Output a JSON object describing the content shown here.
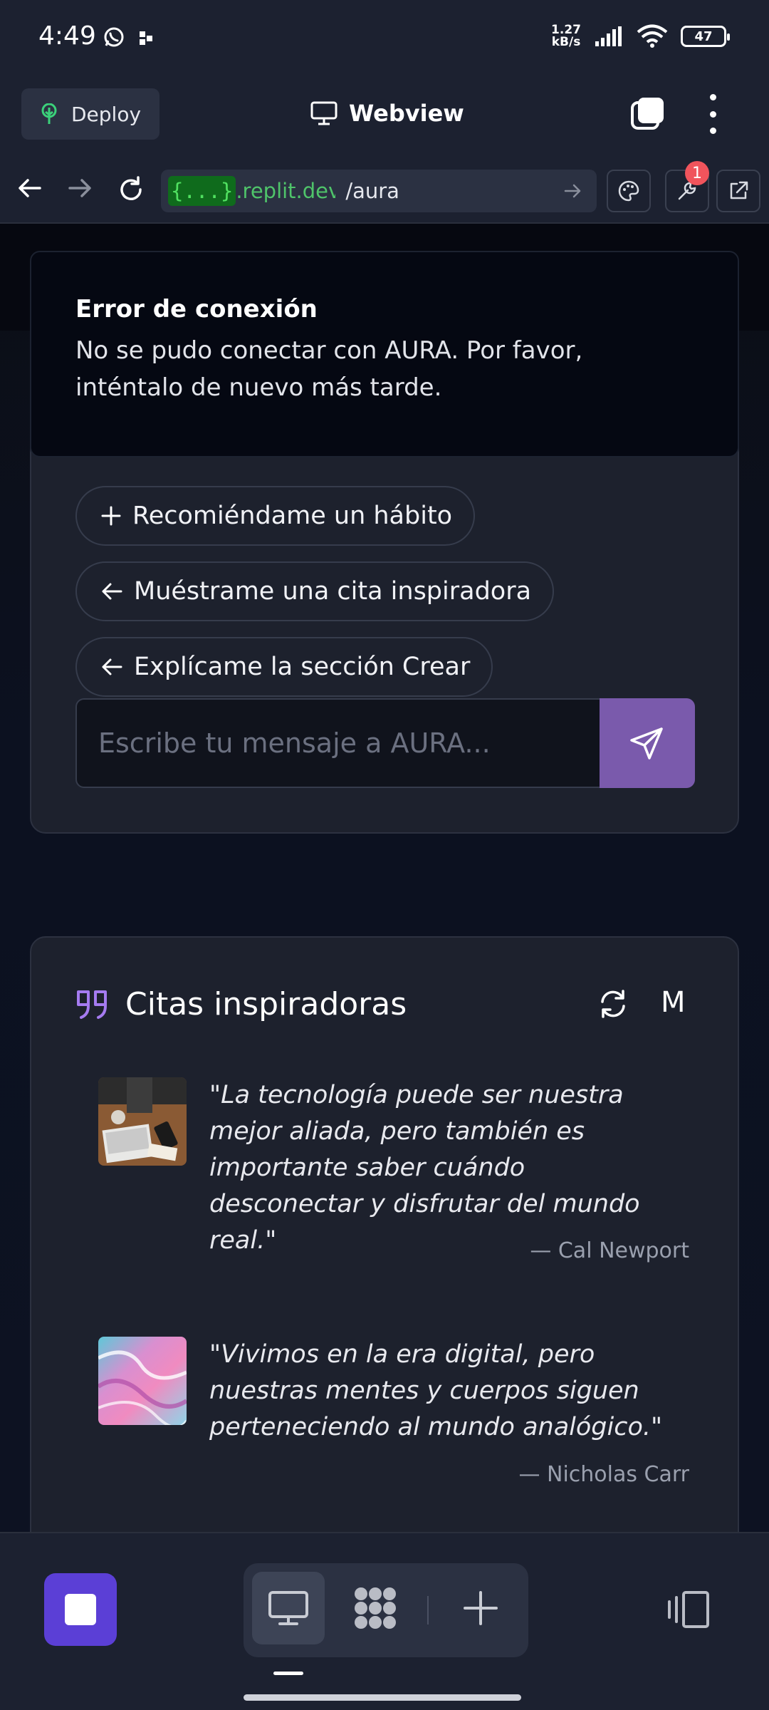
{
  "status_bar": {
    "time": "4:49",
    "net_speed_value": "1.27",
    "net_speed_unit": "kB/s",
    "battery": "47",
    "icons": [
      "whatsapp-icon",
      "notification-icon",
      "signal-icon",
      "wifi-icon",
      "battery-icon"
    ]
  },
  "app_bar": {
    "deploy_label": "Deploy",
    "title": "Webview",
    "icons": [
      "deploy-tree-icon",
      "monitor-icon",
      "tabs-icon",
      "overflow-menu-icon"
    ]
  },
  "url_bar": {
    "chip": "{...}",
    "domain": ".replit.dev",
    "path": "/aura",
    "console_badge": "1",
    "icons": [
      "back-icon",
      "forward-icon",
      "reload-icon",
      "go-arrow-icon",
      "palette-icon",
      "wrench-icon",
      "external-link-icon"
    ]
  },
  "toast": {
    "title": "Error de conexión",
    "message": "No se pudo conectar con AURA. Por favor, inténtalo de nuevo más tarde."
  },
  "chat": {
    "suggestions": [
      {
        "icon": "plus-icon",
        "label": "Recomiéndame un hábito"
      },
      {
        "icon": "arrow-left-icon",
        "label": "Muéstrame una cita inspiradora"
      },
      {
        "icon": "arrow-left-icon",
        "label": "Explícame la sección Crear"
      }
    ],
    "input_placeholder": "Escribe tu mensaje a AURA...",
    "send_icon": "send-icon",
    "colors": {
      "send": "#7a5aac"
    }
  },
  "quotes": {
    "title": "Citas inspiradoras",
    "m_label": "M",
    "icons": [
      "quote-icon",
      "refresh-icon"
    ],
    "items": [
      {
        "text": "\"La tecnología puede ser nuestra mejor aliada, pero también es importante saber cuándo desconectar y disfrutar del mundo real.\"",
        "author": "— Cal Newport",
        "image": "desk-laptop-photo"
      },
      {
        "text": "\"Vivimos en la era digital, pero nuestras mentes y cuerpos siguen perteneciendo al mundo analógico.\"",
        "author": "— Nicholas Carr",
        "image": "pink-marble-abstract"
      }
    ]
  },
  "bottom_bar": {
    "icons": [
      "stop-icon",
      "desktop-preview-icon",
      "workspace-grid-icon",
      "add-icon",
      "panel-icon"
    ],
    "colors": {
      "stop": "#5b3fd6"
    }
  }
}
